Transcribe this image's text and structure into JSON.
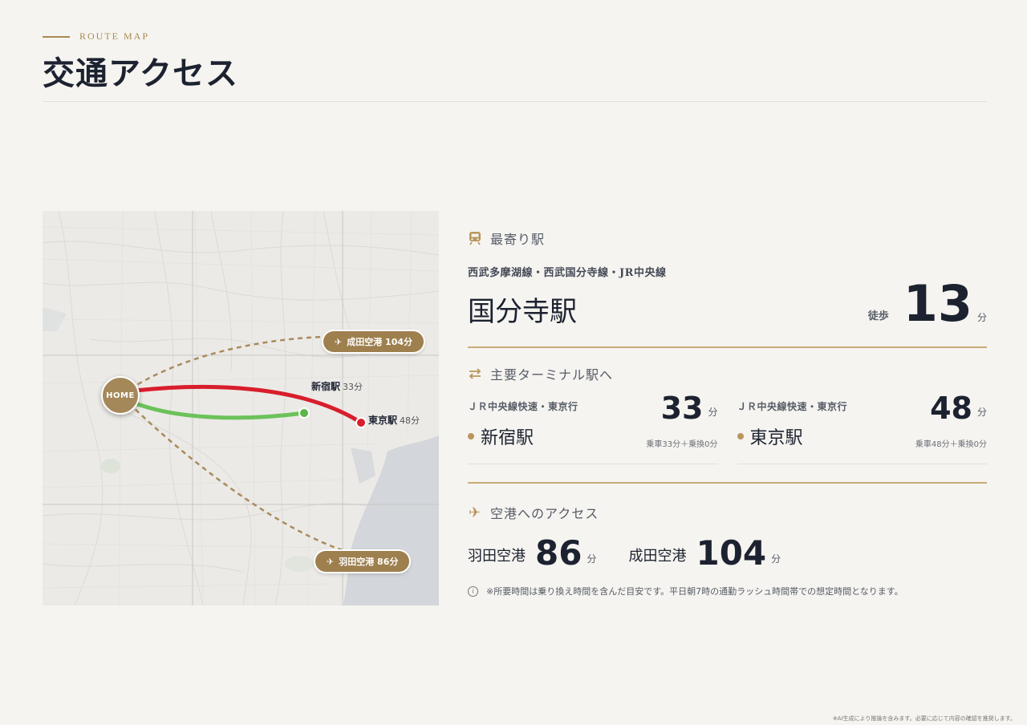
{
  "header": {
    "eyebrow": "ROUTE MAP",
    "title": "交通アクセス"
  },
  "map": {
    "home_label": "HOME",
    "shinjuku": {
      "name": "新宿駅",
      "time": "33分"
    },
    "tokyo": {
      "name": "東京駅",
      "time": "48分"
    },
    "narita_pill": "成田空港 104分",
    "haneda_pill": "羽田空港 86分",
    "colors": {
      "red_line": "#d81e2c",
      "green_line": "#6cc25a",
      "dashed": "#a88b5d",
      "pin": "#a5885a"
    }
  },
  "nearest": {
    "heading": "最寄り駅",
    "lines": "西武多摩湖線・西武国分寺線・JR中央線",
    "station": "国分寺駅",
    "walk_label": "徒歩",
    "walk_minutes": "13",
    "unit": "分"
  },
  "terminals": {
    "heading": "主要ターミナル駅へ",
    "items": [
      {
        "line": "ＪＲ中央線快速・東京行",
        "station": "新宿駅",
        "minutes": "33",
        "unit": "分",
        "breakdown": "乗車33分＋乗換0分"
      },
      {
        "line": "ＪＲ中央線快速・東京行",
        "station": "東京駅",
        "minutes": "48",
        "unit": "分",
        "breakdown": "乗車48分＋乗換0分"
      }
    ]
  },
  "airports": {
    "heading": "空港へのアクセス",
    "items": [
      {
        "name": "羽田空港",
        "minutes": "86",
        "unit": "分"
      },
      {
        "name": "成田空港",
        "minutes": "104",
        "unit": "分"
      }
    ],
    "note": "※所要時間は乗り換え時間を含んだ目安です。平日朝7時の通勤ラッシュ時間帯での想定時間となります。"
  },
  "footer": "※AI生成により推論を含みます。必要に応じて内容の確認を推奨します。",
  "theme": {
    "gold": "#a98a54",
    "navy": "#1c2230",
    "background": "#f6f4f0"
  }
}
